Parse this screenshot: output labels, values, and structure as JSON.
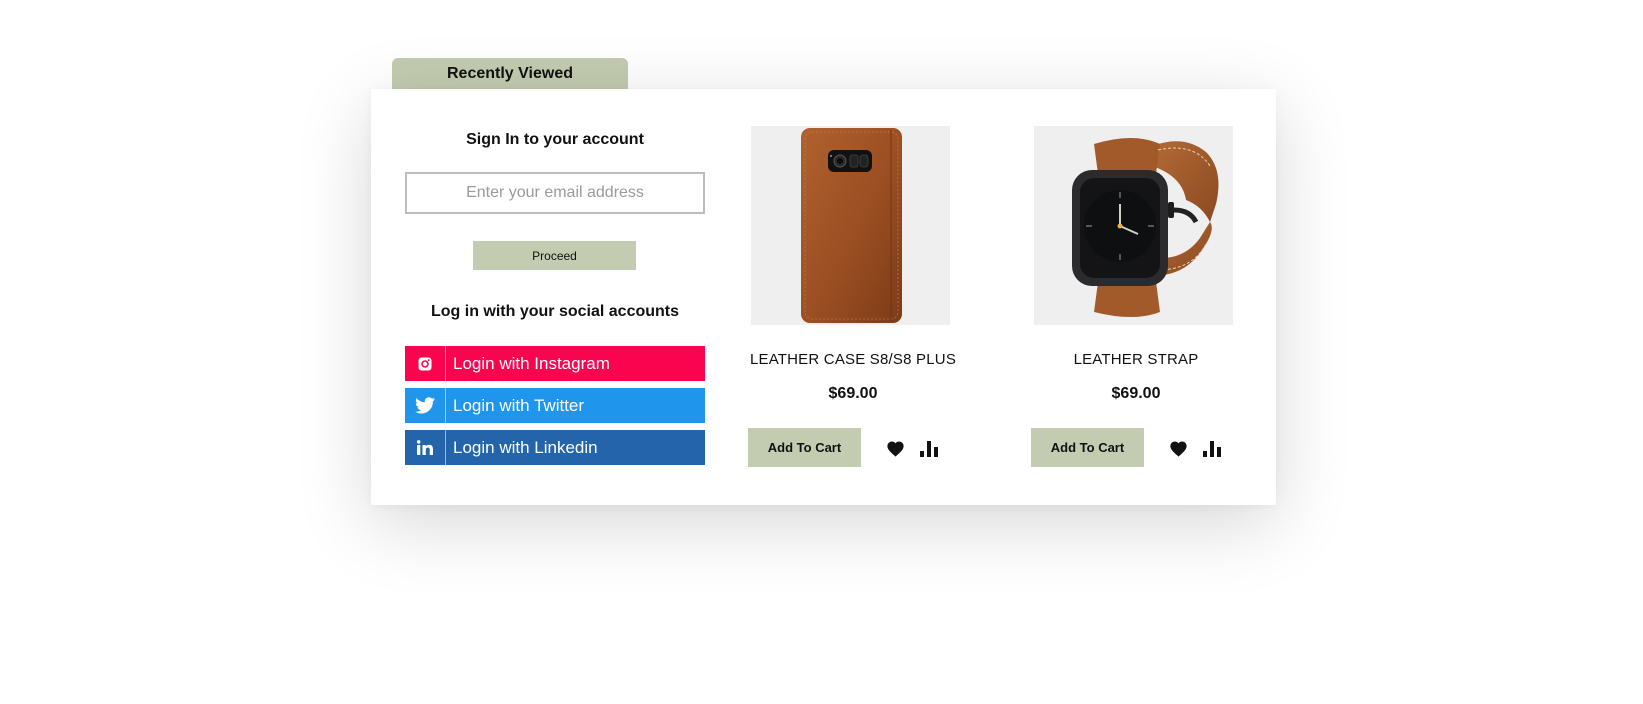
{
  "recently_viewed_tab": "Recently Viewed",
  "signin": {
    "title": "Sign In to your account",
    "email_placeholder": "Enter your email address",
    "proceed_label": "Proceed"
  },
  "social": {
    "title": "Log in with your social accounts",
    "buttons": [
      {
        "label": "Login with Instagram",
        "icon": "instagram-icon",
        "color": "#fa0450"
      },
      {
        "label": "Login with Twitter",
        "icon": "twitter-icon",
        "color": "#1f95ec"
      },
      {
        "label": "Login with Linkedin",
        "icon": "linkedin-icon",
        "color": "#2364aa"
      }
    ]
  },
  "products": [
    {
      "name": "LEATHER CASE S8/S8 PLUS",
      "price": "$69.00",
      "cart_label": "Add To Cart"
    },
    {
      "name": "LEATHER STRAP",
      "price": "$69.00",
      "cart_label": "Add To Cart"
    }
  ],
  "colors": {
    "accent": "#c3cbb0",
    "instagram": "#fa0450",
    "twitter": "#1f95ec",
    "linkedin": "#2364aa"
  }
}
